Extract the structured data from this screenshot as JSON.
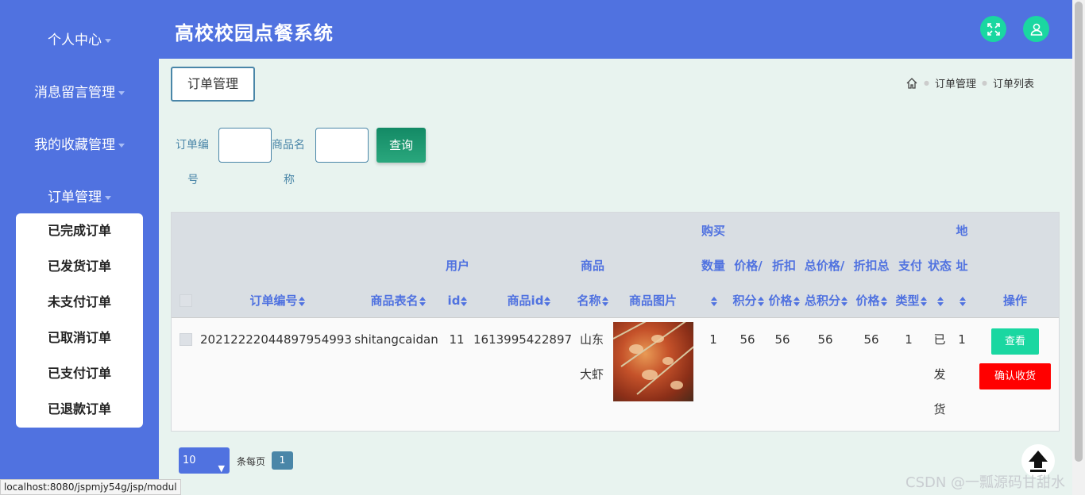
{
  "sidebar": {
    "menus": [
      {
        "label": "个人中心"
      },
      {
        "label": "消息留言管理"
      },
      {
        "label": "我的收藏管理"
      },
      {
        "label": "订单管理"
      }
    ],
    "submenu": [
      {
        "label": "已完成订单"
      },
      {
        "label": "已发货订单"
      },
      {
        "label": "未支付订单"
      },
      {
        "label": "已取消订单"
      },
      {
        "label": "已支付订单"
      },
      {
        "label": "已退款订单"
      }
    ]
  },
  "header": {
    "title": "高校校园点餐系统",
    "fullscreen_icon": "expand-icon",
    "user_icon": "user-icon",
    "accent": "#1ad7a1",
    "bg": "#5072e0"
  },
  "content": {
    "page_tag": "订单管理",
    "breadcrumb": [
      "订单管理",
      "订单列表"
    ],
    "search": {
      "order_no_label_1": "订单编",
      "order_no_label_2": "号",
      "product_name_label_1": "商品名",
      "product_name_label_2": "称",
      "order_no_value": "",
      "product_name_value": "",
      "query_button": "查询"
    },
    "table": {
      "headers": {
        "order_no": "订单编号",
        "table_name": "商品表名",
        "user_id_1": "用户",
        "user_id_2": "id",
        "product_id": "商品id",
        "product_name_1": "商品",
        "product_name_2": "名称",
        "product_image": "商品图片",
        "quantity_1": "购买",
        "quantity_2": "数量",
        "price_1": "价格/",
        "price_2": "积分",
        "discount_price_1": "折扣",
        "discount_price_2": "价格",
        "total_price_1": "总价格/",
        "total_price_2": "总积分",
        "discount_total_1": "折扣总",
        "discount_total_2": "价格",
        "pay_type_1": "支付",
        "pay_type_2": "类型",
        "status": "状态",
        "address_1": "地",
        "address_2": "址",
        "actions": "操作"
      },
      "rows": [
        {
          "order_no": "20212222044897954993",
          "table_name": "shitangcaidan",
          "user_id": "11",
          "product_id": "1613995422897",
          "product_name_1": "山东",
          "product_name_2": "大虾",
          "quantity": "1",
          "price": "56",
          "discount_price": "56",
          "total_price": "56",
          "discount_total": "56",
          "pay_type": "1",
          "status_1": "已",
          "status_2": "发",
          "status_3": "货",
          "address": "1",
          "view_button": "查看",
          "confirm_button": "确认收货"
        }
      ]
    },
    "pagination": {
      "page_size": "10",
      "per_page_label": "条每页",
      "current_page": "1"
    }
  },
  "status_bar": {
    "url": "localhost:8080/jspmjy54g/jsp/modul"
  },
  "watermark": "CSDN @一瓢源码甘甜水"
}
